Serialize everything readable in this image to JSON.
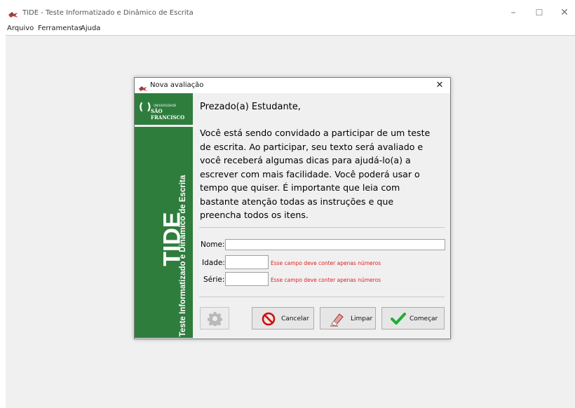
{
  "window": {
    "title": "TIDE - Teste Informatizado e Dinâmico de Escrita",
    "controls": {
      "minimize": "–",
      "maximize": "☐",
      "close": "✕"
    }
  },
  "menu": {
    "items": [
      "Arquivo",
      "Ferramentas",
      "Ajuda"
    ]
  },
  "dialog": {
    "title": "Nova avaliação",
    "close": "✕",
    "logo": {
      "line1": "UNIVERSIDADE",
      "line2": "SÃO FRANCISCO"
    },
    "brand": "TIDE",
    "brand_subtitle": "Teste Informatizado e Dinâmico de Escrita",
    "greeting": "Prezado(a) Estudante,",
    "message_lines": [
      "Você está sendo convidado a participar de um teste",
      "de escrita. Ao participar, seu texto será avaliado e",
      "você receberá algumas dicas para ajudá-lo(a) a",
      "escrever com mais facilidade. Você poderá usar o",
      "tempo que quiser. É importante que leia com",
      "bastante atenção todas as instruções e que",
      "preencha todos os itens."
    ],
    "form": {
      "nome_label": "Nome:",
      "nome_value": "",
      "idade_label": "Idade:",
      "idade_value": "",
      "serie_label": "Série:",
      "serie_value": "",
      "idade_error": "Esse campo deve conter apenas números",
      "serie_error": "Esse campo deve conter apenas números"
    },
    "buttons": {
      "cancel": "Cancelar",
      "clear": "Limpar",
      "start": "Começar"
    }
  },
  "colors": {
    "brand_green": "#2e7d3d",
    "error_red": "#e02020",
    "start_check": "#1fae2f",
    "cancel_red": "#d01010"
  }
}
